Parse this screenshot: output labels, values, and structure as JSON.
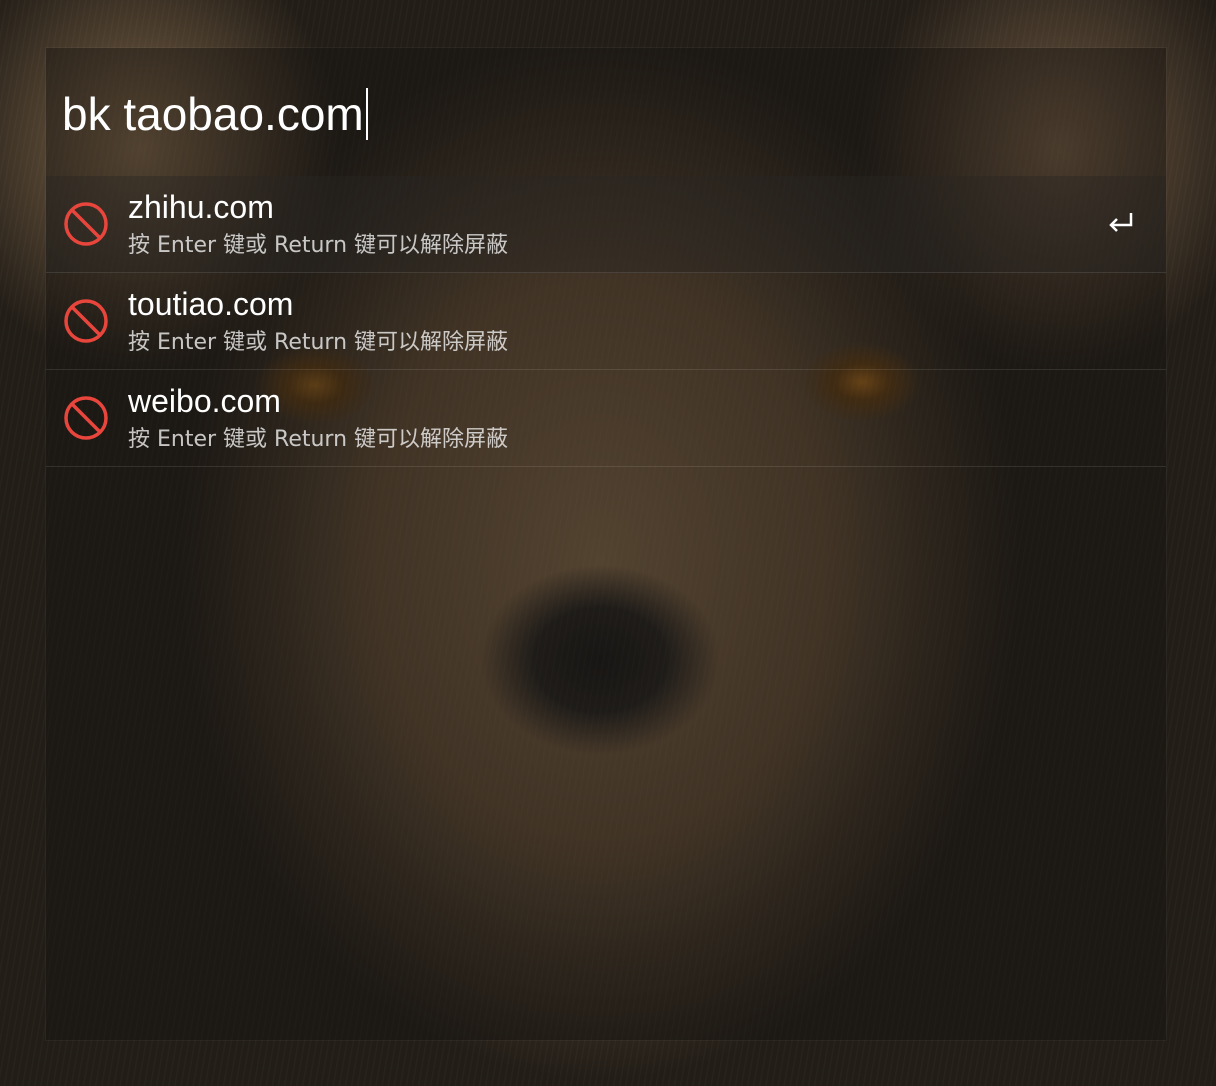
{
  "launcher": {
    "query": "bk taobao.com"
  },
  "results": [
    {
      "title": "zhihu.com",
      "subtitle": "按 Enter 键或 Return 键可以解除屏蔽",
      "icon": "block-icon",
      "selected": true
    },
    {
      "title": "toutiao.com",
      "subtitle": "按 Enter 键或 Return 键可以解除屏蔽",
      "icon": "block-icon",
      "selected": false
    },
    {
      "title": "weibo.com",
      "subtitle": "按 Enter 键或 Return 键可以解除屏蔽",
      "icon": "block-icon",
      "selected": false
    }
  ],
  "selected_action_icon": "return-key-icon",
  "colors": {
    "block_icon": "#e8463c",
    "text": "#ffffff"
  }
}
